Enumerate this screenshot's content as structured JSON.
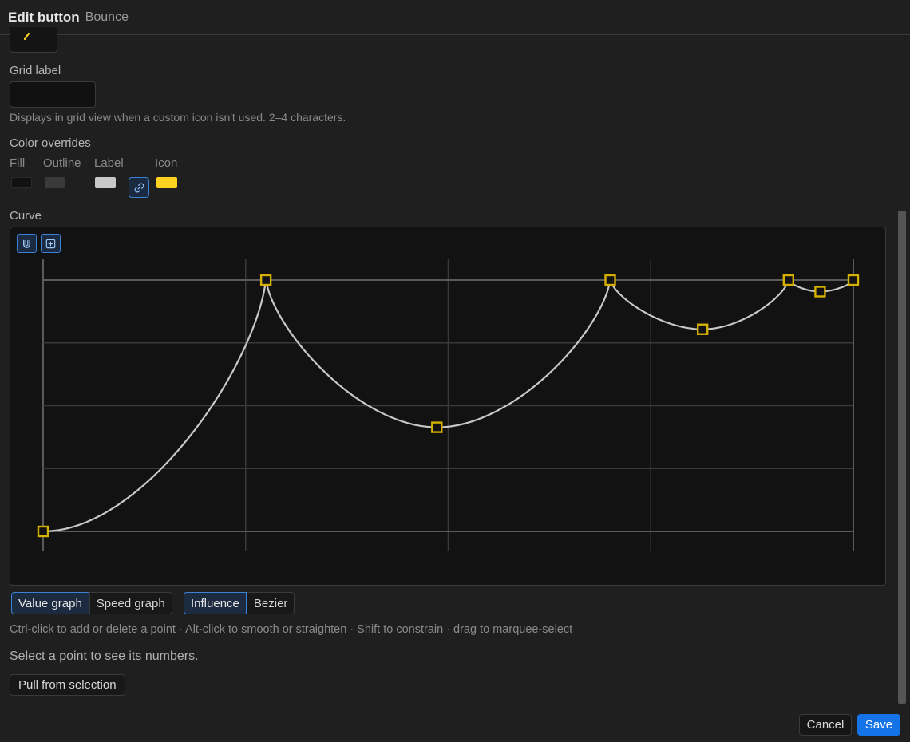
{
  "header": {
    "title": "Edit button",
    "subtitle": "Bounce"
  },
  "grid_label": {
    "label": "Grid label",
    "value": "",
    "hint": "Displays in grid view when a custom icon isn't used. 2–4 characters."
  },
  "color_overrides": {
    "label": "Color overrides",
    "items": [
      {
        "label": "Fill",
        "color": "#111111"
      },
      {
        "label": "Outline",
        "color": "#3a3a3a"
      },
      {
        "label": "Label",
        "color": "#c8c8c8"
      },
      {
        "label": "Icon",
        "color": "#ffd21f"
      }
    ],
    "link_icon": "link-icon"
  },
  "curve": {
    "label": "Curve",
    "tools": [
      "magnet-icon",
      "add-point-icon"
    ],
    "points": [
      {
        "t": 0.0,
        "v": 0.0
      },
      {
        "t": 0.275,
        "v": 1.0
      },
      {
        "t": 0.486,
        "v": 0.414
      },
      {
        "t": 0.7,
        "v": 1.0
      },
      {
        "t": 0.814,
        "v": 0.804
      },
      {
        "t": 0.92,
        "v": 1.0
      },
      {
        "t": 0.959,
        "v": 0.954
      },
      {
        "t": 1.0,
        "v": 1.0
      }
    ]
  },
  "graph_mode": {
    "options": [
      "Value graph",
      "Speed graph"
    ],
    "selected": "Value graph"
  },
  "handle_mode": {
    "options": [
      "Influence",
      "Bezier"
    ],
    "selected": "Influence"
  },
  "instructions": "Ctrl-click to add or delete a point · Alt-click to smooth or straighten · Shift to constrain · drag to marquee-select",
  "selection_message": "Select a point to see its numbers.",
  "pull_button": "Pull from selection",
  "footer": {
    "cancel": "Cancel",
    "save": "Save"
  },
  "colors": {
    "accent": "#1473e6",
    "point": "#d4b000",
    "curve": "#c8c8c8"
  }
}
